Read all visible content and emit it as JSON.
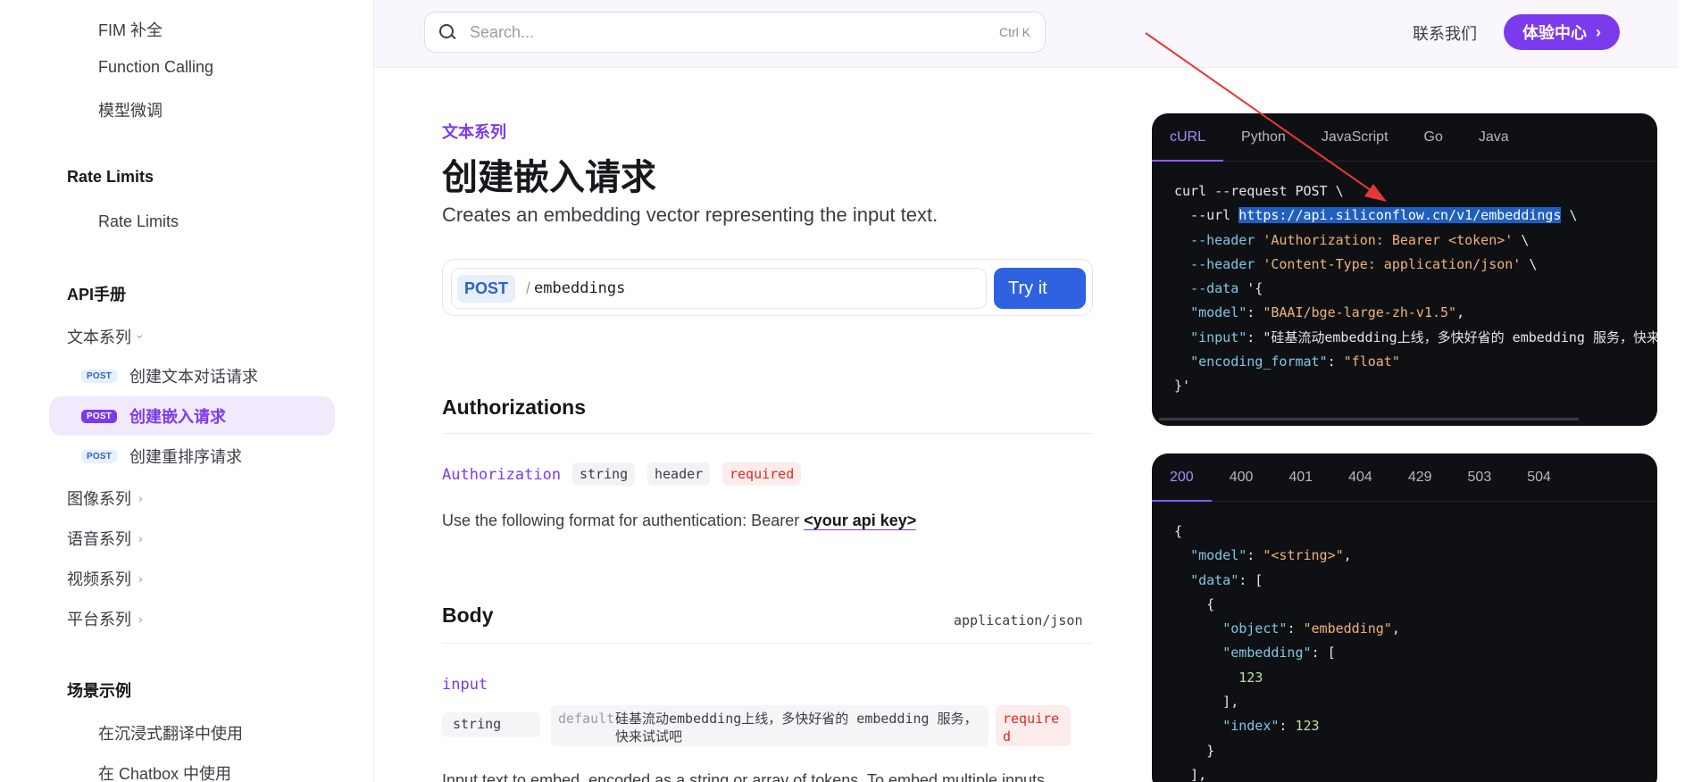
{
  "sidebar": {
    "top_items": [
      "FIM 补全",
      "Function Calling",
      "模型微调"
    ],
    "rate_limits": {
      "heading": "Rate Limits",
      "item": "Rate Limits"
    },
    "api": {
      "heading": "API手册",
      "text_group": "文本系列",
      "endpoints": [
        {
          "method": "POST",
          "label": "创建文本对话请求"
        },
        {
          "method": "POST",
          "label": "创建嵌入请求"
        },
        {
          "method": "POST",
          "label": "创建重排序请求"
        }
      ],
      "groups": [
        "图像系列",
        "语音系列",
        "视频系列",
        "平台系列"
      ]
    },
    "scenarios": {
      "heading": "场景示例",
      "items": [
        "在沉浸式翻译中使用",
        "在 Chatbox 中使用"
      ]
    }
  },
  "topbar": {
    "search_placeholder": "Search...",
    "search_shortcut": "Ctrl K",
    "contact": "联系我们",
    "experience": "体验中心"
  },
  "page": {
    "eyebrow": "文本系列",
    "title": "创建嵌入请求",
    "description": "Creates an embedding vector representing the input text.",
    "method": "POST",
    "path": "embeddings",
    "try_label": "Try it"
  },
  "authorizations": {
    "heading": "Authorizations",
    "param": "Authorization",
    "type": "string",
    "location": "header",
    "required": "required",
    "text": "Use the following format for authentication: Bearer ",
    "key_text": "<your api key>"
  },
  "body": {
    "heading": "Body",
    "content_type": "application/json",
    "param": "input",
    "type": "string",
    "default_label": "default:",
    "default_value": "硅基流动embedding上线，多快好省的 embedding 服务，快来试试吧",
    "required": "required",
    "description": "Input text to embed, encoded as a string or array of tokens. To embed multiple inputs"
  },
  "request_panel": {
    "tabs": [
      "cURL",
      "Python",
      "JavaScript",
      "Go",
      "Java"
    ],
    "active_tab": "cURL",
    "lines": [
      "curl --request POST \\",
      "  --url https://api.siliconflow.cn/v1/embeddings \\",
      "  --header 'Authorization: Bearer <token>' \\",
      "  --header 'Content-Type: application/json' \\",
      "  --data '{",
      "  \"model\": \"BAAI/bge-large-zh-v1.5\",",
      "  \"input\": \"硅基流动embedding上线，多快好省的 embedding 服务，快来",
      "  \"encoding_format\": \"float\"",
      "}'"
    ],
    "selected_url": "https://api.siliconflow.cn/v1/embeddings"
  },
  "response_panel": {
    "tabs": [
      "200",
      "400",
      "401",
      "404",
      "429",
      "503",
      "504"
    ],
    "active_tab": "200",
    "lines": [
      "{",
      "  \"model\": \"<string>\",",
      "  \"data\": [",
      "    {",
      "      \"object\": \"embedding\",",
      "      \"embedding\": [",
      "        123",
      "      ],",
      "      \"index\": 123",
      "    }",
      "  ],"
    ]
  },
  "colors": {
    "accent": "#7c3aed",
    "method_blue": "#2f62c7",
    "try_button": "#2f62e0",
    "required_red": "#d92d20",
    "code_bg": "#0f1014",
    "annotation_arrow": "#e53935"
  }
}
